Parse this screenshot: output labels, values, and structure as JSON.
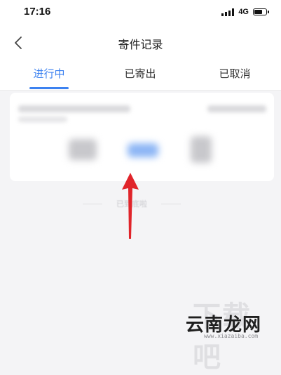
{
  "status_bar": {
    "time": "17:16",
    "network": "4G",
    "battery_level": 0.7
  },
  "header": {
    "back_icon": "chevron-left-icon",
    "title": "寄件记录"
  },
  "tabs": [
    {
      "label": "进行中",
      "active": true
    },
    {
      "label": "已寄出",
      "active": false
    },
    {
      "label": "已取消",
      "active": false
    }
  ],
  "list_end_hint": "已到底啦",
  "watermark": {
    "brand": "云南龙网",
    "url": "www.xiazaiba.com"
  },
  "colors": {
    "accent": "#3d82f0",
    "arrow": "#e0242a",
    "background": "#f4f4f6"
  }
}
